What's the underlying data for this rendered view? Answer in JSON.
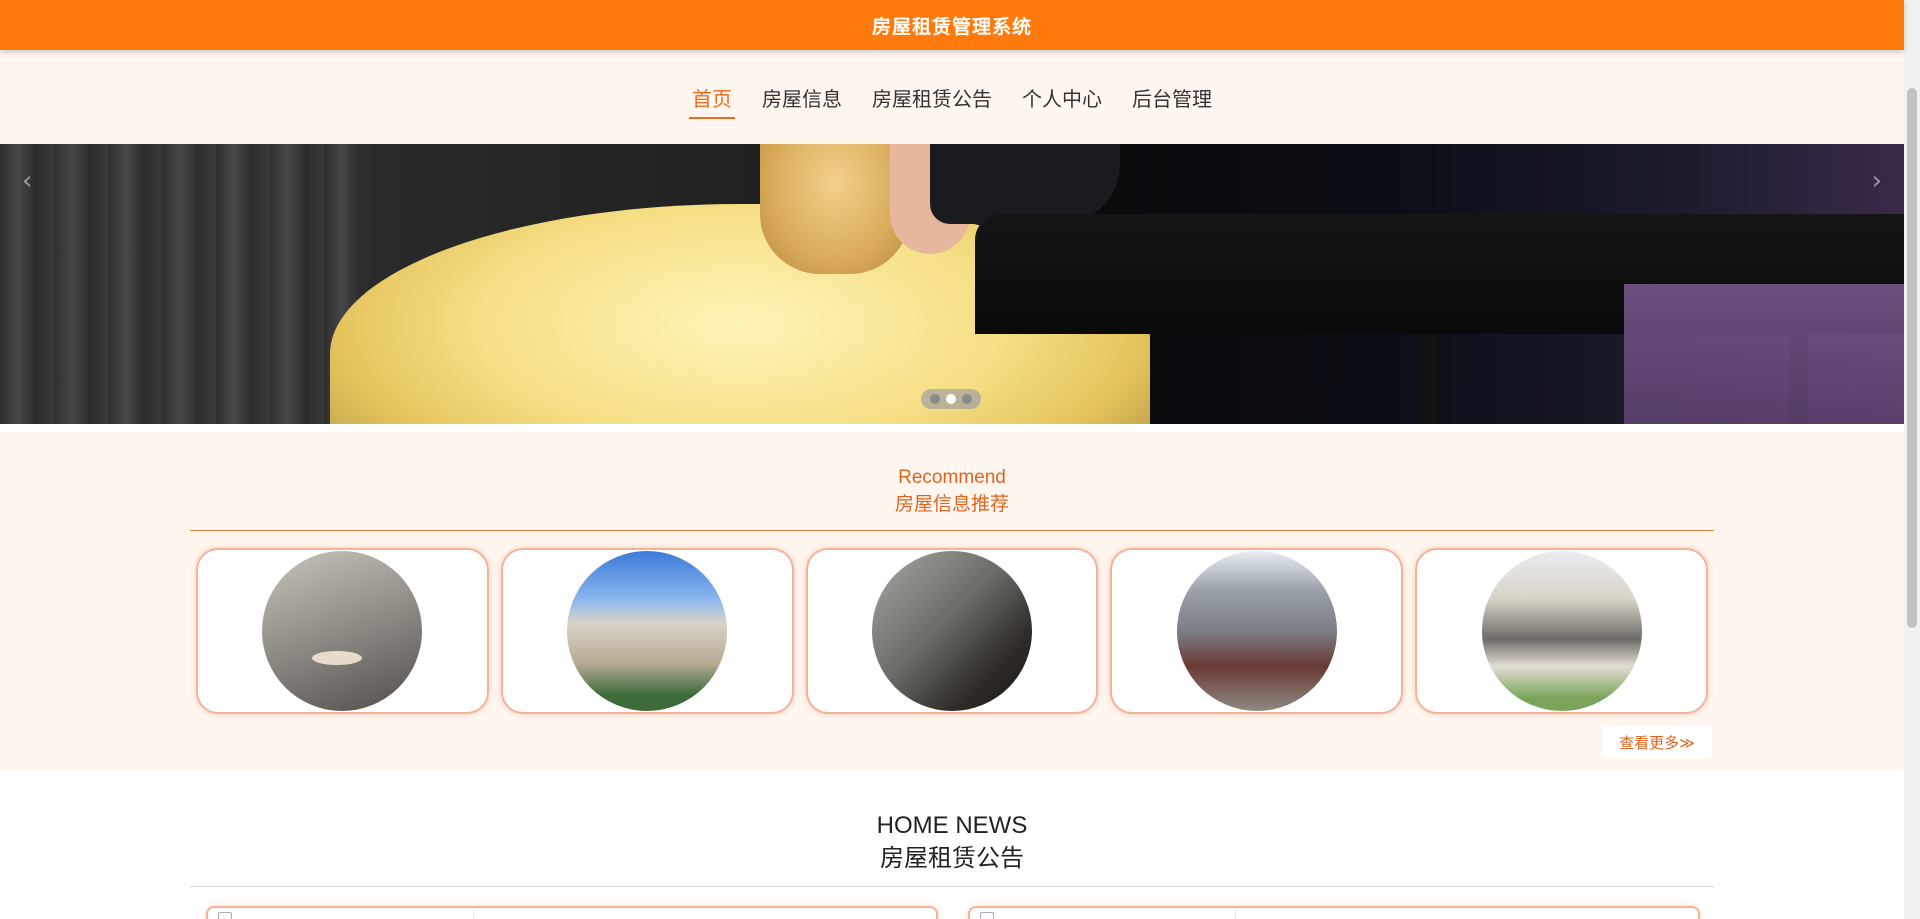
{
  "header": {
    "title": "房屋租赁管理系统"
  },
  "nav": {
    "items": [
      {
        "label": "首页",
        "active": true
      },
      {
        "label": "房屋信息",
        "active": false
      },
      {
        "label": "房屋租赁公告",
        "active": false
      },
      {
        "label": "个人中心",
        "active": false
      },
      {
        "label": "后台管理",
        "active": false
      }
    ]
  },
  "carousel": {
    "prev_icon": "chevron-left-icon",
    "next_icon": "chevron-right-icon",
    "prev_glyph": "‹",
    "next_glyph": "›",
    "slide_count": 3,
    "active_index": 1
  },
  "recommend": {
    "title_en": "Recommend",
    "title_cn": "房屋信息推荐",
    "more_label": "查看更多≫"
  },
  "news": {
    "title_en": "HOME NEWS",
    "title_cn": "房屋租赁公告"
  },
  "colors": {
    "accent": "#ff7a0d",
    "accent_text": "#e0641f",
    "section_bg": "#fff6ef"
  }
}
